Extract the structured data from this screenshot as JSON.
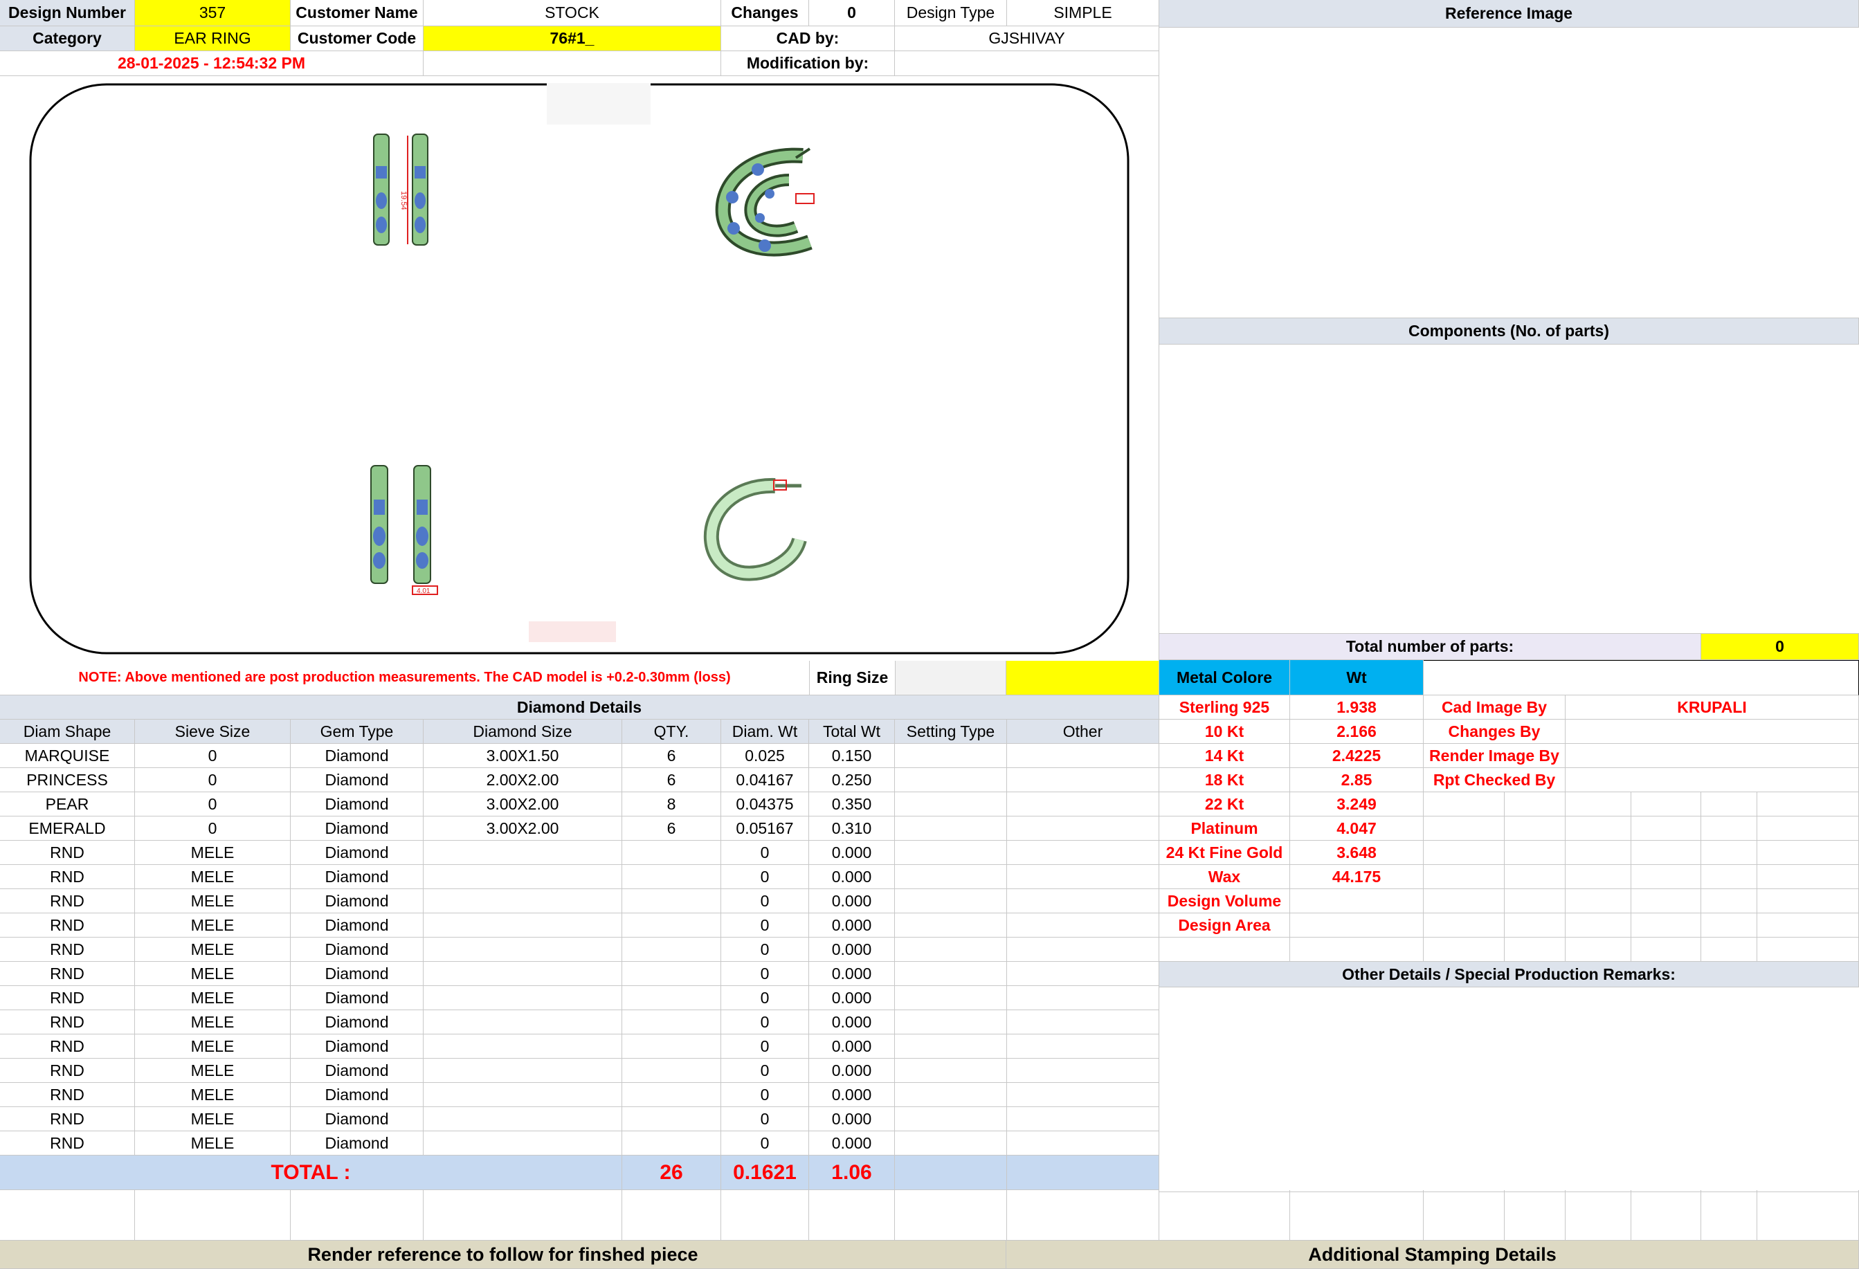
{
  "header": {
    "design_number_label": "Design Number",
    "design_number": "357",
    "customer_name_label": "Customer Name",
    "customer_name": "STOCK",
    "changes_label": "Changes",
    "changes": "0",
    "design_type_label": "Design Type",
    "design_type": "SIMPLE",
    "category_label": "Category",
    "category": "EAR RING",
    "customer_code_label": "Customer Code",
    "customer_code": "76#1_",
    "cad_by_label": "CAD by:",
    "cad_by": "GJSHIVAY",
    "timestamp": "28-01-2025 - 12:54:32 PM",
    "modification_by_label": "Modification by:",
    "modification_by": ""
  },
  "cad_image": {
    "dim_top": "19.54",
    "dim_bottom": "4.01"
  },
  "note": "NOTE: Above mentioned are post production measurements. The CAD model is +0.2-0.30mm (loss)",
  "ring_size_label": "Ring Size",
  "ring_size": "",
  "diamond": {
    "title": "Diamond Details",
    "columns": [
      "Diam Shape",
      "Sieve Size",
      "Gem Type",
      "Diamond Size",
      "QTY.",
      "Diam. Wt",
      "Total Wt",
      "Setting Type",
      "Other"
    ],
    "rows": [
      [
        "MARQUISE",
        "0",
        "Diamond",
        "3.00X1.50",
        "6",
        "0.025",
        "0.150",
        "",
        ""
      ],
      [
        "PRINCESS",
        "0",
        "Diamond",
        "2.00X2.00",
        "6",
        "0.04167",
        "0.250",
        "",
        ""
      ],
      [
        "PEAR",
        "0",
        "Diamond",
        "3.00X2.00",
        "8",
        "0.04375",
        "0.350",
        "",
        ""
      ],
      [
        "EMERALD",
        "0",
        "Diamond",
        "3.00X2.00",
        "6",
        "0.05167",
        "0.310",
        "",
        ""
      ],
      [
        "RND",
        "MELE",
        "Diamond",
        "",
        "",
        "0",
        "0.000",
        "",
        ""
      ],
      [
        "RND",
        "MELE",
        "Diamond",
        "",
        "",
        "0",
        "0.000",
        "",
        ""
      ],
      [
        "RND",
        "MELE",
        "Diamond",
        "",
        "",
        "0",
        "0.000",
        "",
        ""
      ],
      [
        "RND",
        "MELE",
        "Diamond",
        "",
        "",
        "0",
        "0.000",
        "",
        ""
      ],
      [
        "RND",
        "MELE",
        "Diamond",
        "",
        "",
        "0",
        "0.000",
        "",
        ""
      ],
      [
        "RND",
        "MELE",
        "Diamond",
        "",
        "",
        "0",
        "0.000",
        "",
        ""
      ],
      [
        "RND",
        "MELE",
        "Diamond",
        "",
        "",
        "0",
        "0.000",
        "",
        ""
      ],
      [
        "RND",
        "MELE",
        "Diamond",
        "",
        "",
        "0",
        "0.000",
        "",
        ""
      ],
      [
        "RND",
        "MELE",
        "Diamond",
        "",
        "",
        "0",
        "0.000",
        "",
        ""
      ],
      [
        "RND",
        "MELE",
        "Diamond",
        "",
        "",
        "0",
        "0.000",
        "",
        ""
      ],
      [
        "RND",
        "MELE",
        "Diamond",
        "",
        "",
        "0",
        "0.000",
        "",
        ""
      ],
      [
        "RND",
        "MELE",
        "Diamond",
        "",
        "",
        "0",
        "0.000",
        "",
        ""
      ],
      [
        "RND",
        "MELE",
        "Diamond",
        "",
        "",
        "0",
        "0.000",
        "",
        ""
      ]
    ],
    "total_label": "TOTAL :",
    "total_qty": "26",
    "total_diam_wt": "0.1621",
    "total_wt": "1.06"
  },
  "right": {
    "reference_image_title": "Reference Image",
    "components_title": "Components (No. of parts)",
    "total_parts_label": "Total number of parts:",
    "total_parts": "0",
    "metal_colore_label": "Metal Colore",
    "wt_label": "Wt",
    "metals": [
      {
        "name": "Sterling 925",
        "wt": "1.938"
      },
      {
        "name": "10 Kt",
        "wt": "2.166"
      },
      {
        "name": "14 Kt",
        "wt": "2.4225"
      },
      {
        "name": "18 Kt",
        "wt": "2.85"
      },
      {
        "name": "22 Kt",
        "wt": "3.249"
      },
      {
        "name": "Platinum",
        "wt": "4.047"
      },
      {
        "name": "24 Kt Fine Gold",
        "wt": "3.648"
      },
      {
        "name": "Wax",
        "wt": "44.175"
      },
      {
        "name": "Design Volume",
        "wt": ""
      },
      {
        "name": "Design Area",
        "wt": ""
      }
    ],
    "roles": [
      {
        "label": "Cad Image By",
        "value": "KRUPALI"
      },
      {
        "label": "Changes By",
        "value": ""
      },
      {
        "label": "Render Image By",
        "value": ""
      },
      {
        "label": "Rpt Checked By",
        "value": ""
      }
    ],
    "other_details_title": "Other Details / Special Production Remarks:"
  },
  "footer": {
    "render_reference": "Render reference to follow for finshed piece",
    "additional_stamping": "Additional Stamping Details"
  }
}
